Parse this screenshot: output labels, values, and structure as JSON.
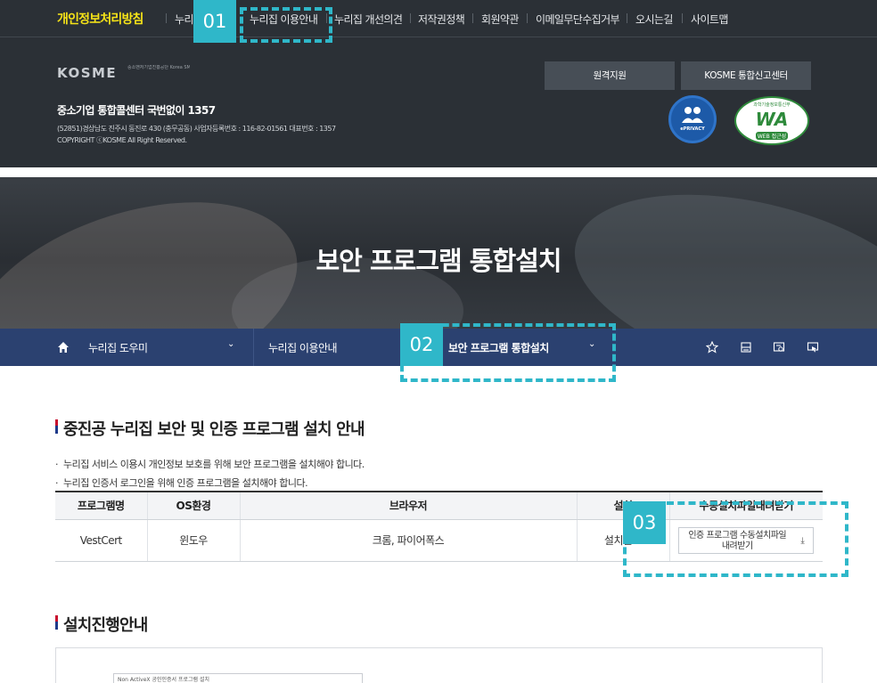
{
  "footer": {
    "links": [
      "개인정보처리방침",
      "누리",
      "누리집 이용안내",
      "누리집 개선의견",
      "저작권정책",
      "회원약관",
      "이메일무단수집거부",
      "오시는길",
      "사이트맵"
    ],
    "logo_text": "KOSME",
    "logo_sub": "중소벤처기업진흥공단 Korea SMEs and Startups Agency",
    "remote_support": "원격지원",
    "report_center": "KOSME 통합신고센터",
    "call_center": "중소기업 통합콜센터 국번없이 1357",
    "address": "(52851)경상남도 진주시 동진로 430 (충무공동) 사업자등록번호 : 116-82-01561 대표번호 : 1357",
    "copyright": "COPYRIGHT ⓒKOSME All Right Reserved.",
    "eprivacy_label": "ePRIVACY",
    "wa_top": "과학기술정보통신부",
    "wa_mark": "WA",
    "wa_bottom": "WEB 접근성"
  },
  "hero": {
    "title": "보안 프로그램 통합설치"
  },
  "breadcrumb": {
    "level1": "누리집 도우미",
    "level2": "누리집 이용안내",
    "level3": "보안 프로그램 통합설치"
  },
  "content": {
    "section1_title": "중진공 누리집 보안 및 인증 프로그램 설치 안내",
    "bullets": [
      "누리집 서비스 이용시 개인정보 보호를 위해 보안 프로그램을 설치해야 합니다.",
      "누리집 인증서 로그인을 위해 인증 프로그램을 설치해야 합니다."
    ],
    "table": {
      "headers": [
        "프로그램명",
        "OS환경",
        "브라우저",
        "설치",
        "수동설치파일내려받기"
      ],
      "rows": [
        {
          "name": "VestCert",
          "os": "윈도우",
          "browser": "크롬, 파이어폭스",
          "install": "설치완료",
          "download": "인증 프로그램 수동설치파일 내려받기"
        }
      ]
    },
    "section2_title": "설치진행안내",
    "install_caption": "Non ActiveX 공인인증서 프로그램 설치"
  },
  "annotations": {
    "marker1": "01",
    "marker2": "02",
    "marker3": "03",
    "color": "#2fb7c9"
  }
}
